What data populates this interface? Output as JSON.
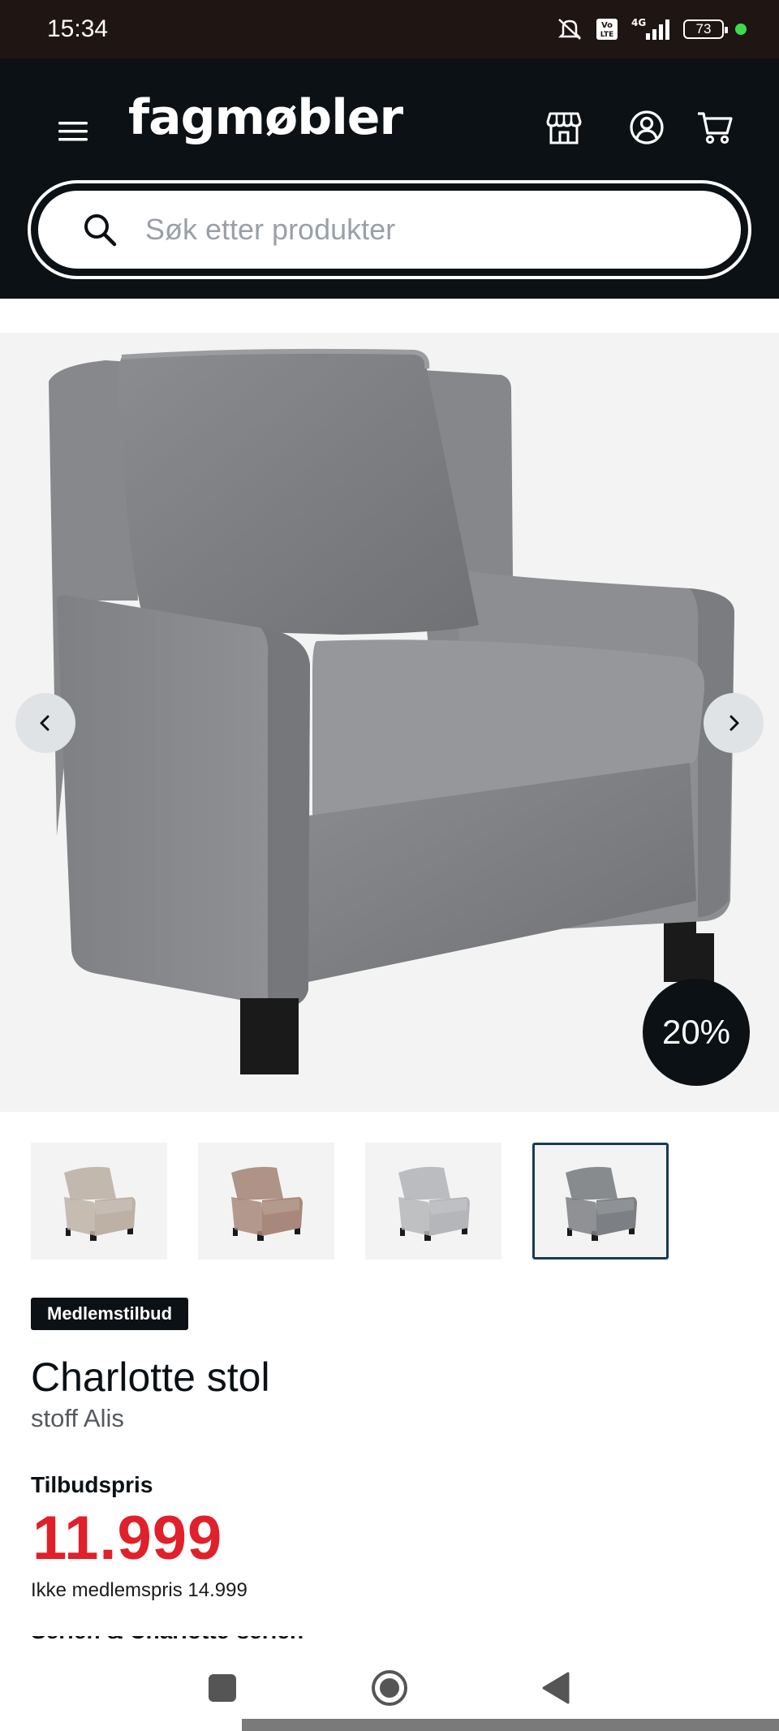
{
  "status_bar": {
    "time": "15:34",
    "battery": "73",
    "network": "4G",
    "icons": [
      "mute-icon",
      "volte-icon",
      "signal-icon",
      "battery-icon"
    ]
  },
  "header": {
    "logo": "fagmøbler",
    "icons": [
      "menu-icon",
      "store-icon",
      "account-icon",
      "cart-icon"
    ]
  },
  "search": {
    "placeholder": "Søk etter produkter"
  },
  "gallery": {
    "discount_badge": "20%",
    "thumbnail_colors": [
      "#bdb1a6",
      "#a7887a",
      "#b4b6b9",
      "#7c7f83"
    ],
    "selected_thumbnail_index": 3
  },
  "product": {
    "badge": "Medlemstilbud",
    "title": "Charlotte stol",
    "subtitle": "stoff Alis",
    "price_label": "Tilbudspris",
    "price": "11.999",
    "non_member_price": "Ikke medlemspris 14.999",
    "next_section_partial": "Serien & Charlotte-serien"
  },
  "colors": {
    "header_bg": "#0b1114",
    "price_red": "#e0202b",
    "status_bar_bg": "#1f1512"
  }
}
